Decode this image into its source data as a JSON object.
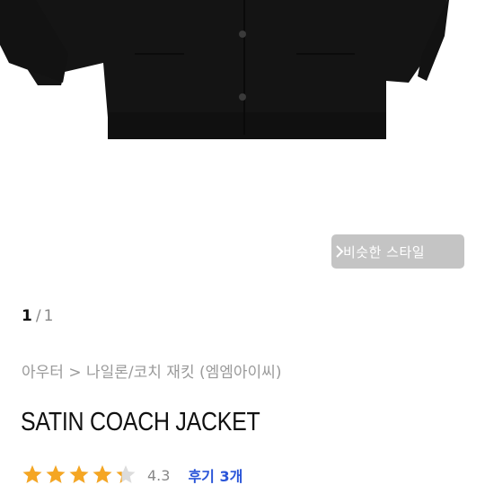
{
  "product_image": {
    "subject": "black satin coach jacket",
    "color": "#141414"
  },
  "similar_style_button": {
    "label": "비슷한 스타일",
    "icon": "chevron-right-icon"
  },
  "pager": {
    "current": "1",
    "separator": "/",
    "total": "1"
  },
  "breadcrumb": {
    "text": "아우터 > 나일론/코치 재킷 (엠엠아이씨)"
  },
  "product": {
    "title": "SATIN COACH JACKET"
  },
  "rating": {
    "value": "4.3",
    "stars": 4.3,
    "max": 5,
    "star_color": "#f5a623",
    "empty_color": "#dcdcdc",
    "review_label": "후기 3개"
  }
}
